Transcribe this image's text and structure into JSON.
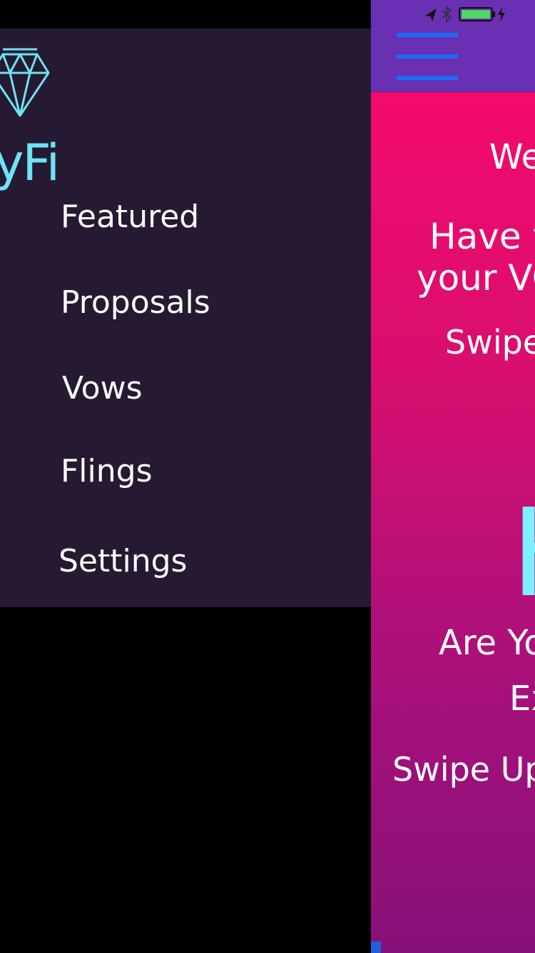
{
  "app": {
    "logo_text": "yFi",
    "brand_color": "#6fe3f5"
  },
  "drawer": {
    "items": [
      {
        "label": "Featured"
      },
      {
        "label": "Proposals"
      },
      {
        "label": "Vows"
      },
      {
        "label": "Flings"
      },
      {
        "label": "Settings"
      }
    ]
  },
  "main": {
    "lines": {
      "line1": "We",
      "line2": "Have y",
      "line3": "your VO",
      "line4": "Swipe",
      "big_letter": "H",
      "line5": "Are Yo",
      "line6": "Ex",
      "line7": "Swipe Up"
    },
    "colors": {
      "navbar": "#6930b3",
      "hamburger": "#1e6bf5",
      "gradient_top": "#f30a6c",
      "gradient_bottom": "#861179",
      "accent_text": "#7df0ff"
    }
  },
  "status_bar": {
    "icons": [
      "location-arrow-icon",
      "bluetooth-icon",
      "battery-icon",
      "charging-bolt-icon"
    ],
    "battery_color": "#4cd964"
  }
}
